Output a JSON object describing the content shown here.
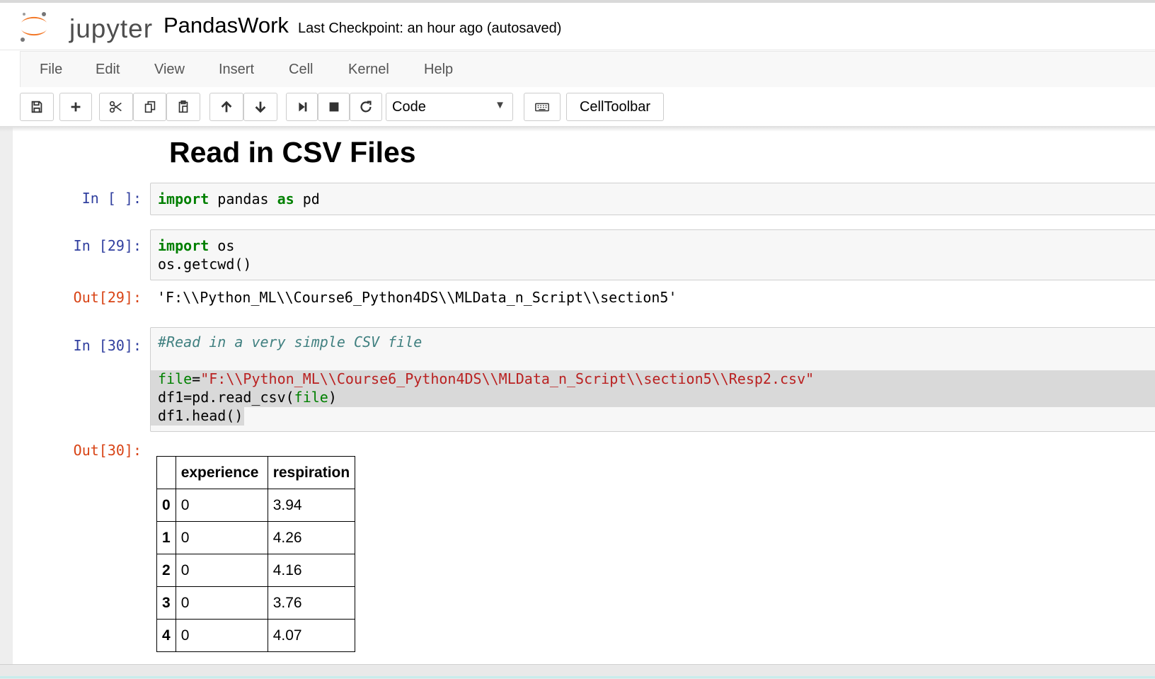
{
  "app": {
    "logo_text": "jupyter",
    "notebook_name": "PandasWork",
    "checkpoint": "Last Checkpoint: an hour ago (autosaved)"
  },
  "menu": [
    "File",
    "Edit",
    "View",
    "Insert",
    "Cell",
    "Kernel",
    "Help"
  ],
  "toolbar": {
    "icons": [
      "save-icon",
      "plus-icon",
      "cut-icon",
      "copy-icon",
      "paste-icon",
      "arrow-up-icon",
      "arrow-down-icon",
      "step-forward-icon",
      "stop-icon",
      "refresh-icon",
      "keyboard-icon"
    ],
    "cell_type": "Code",
    "celltoolbar_label": "CellToolbar"
  },
  "heading": "Read in CSV Files",
  "cells": [
    {
      "prompt": "In [ ]:",
      "lines": [
        "import pandas as pd"
      ]
    },
    {
      "prompt": "In [29]:",
      "lines": [
        "import os",
        "os.getcwd()"
      ],
      "output_prompt": "Out[29]:",
      "output": "'F:\\\\Python_ML\\\\Course6_Python4DS\\\\MLData_n_Script\\\\section5'"
    },
    {
      "prompt": "In [30]:",
      "lines": [
        "#Read in a very simple CSV file",
        "",
        "file=\"F:\\\\Python_ML\\\\Course6_Python4DS\\\\MLData_n_Script\\\\section5\\\\Resp2.csv\"",
        "df1=pd.read_csv(file)",
        "df1.head()"
      ],
      "output_prompt": "Out[30]:"
    }
  ],
  "table": {
    "columns": [
      "",
      "experience",
      "respiration"
    ],
    "rows": [
      [
        "0",
        "0",
        "3.94"
      ],
      [
        "1",
        "0",
        "4.26"
      ],
      [
        "2",
        "0",
        "4.16"
      ],
      [
        "3",
        "0",
        "3.76"
      ],
      [
        "4",
        "0",
        "4.07"
      ]
    ]
  }
}
